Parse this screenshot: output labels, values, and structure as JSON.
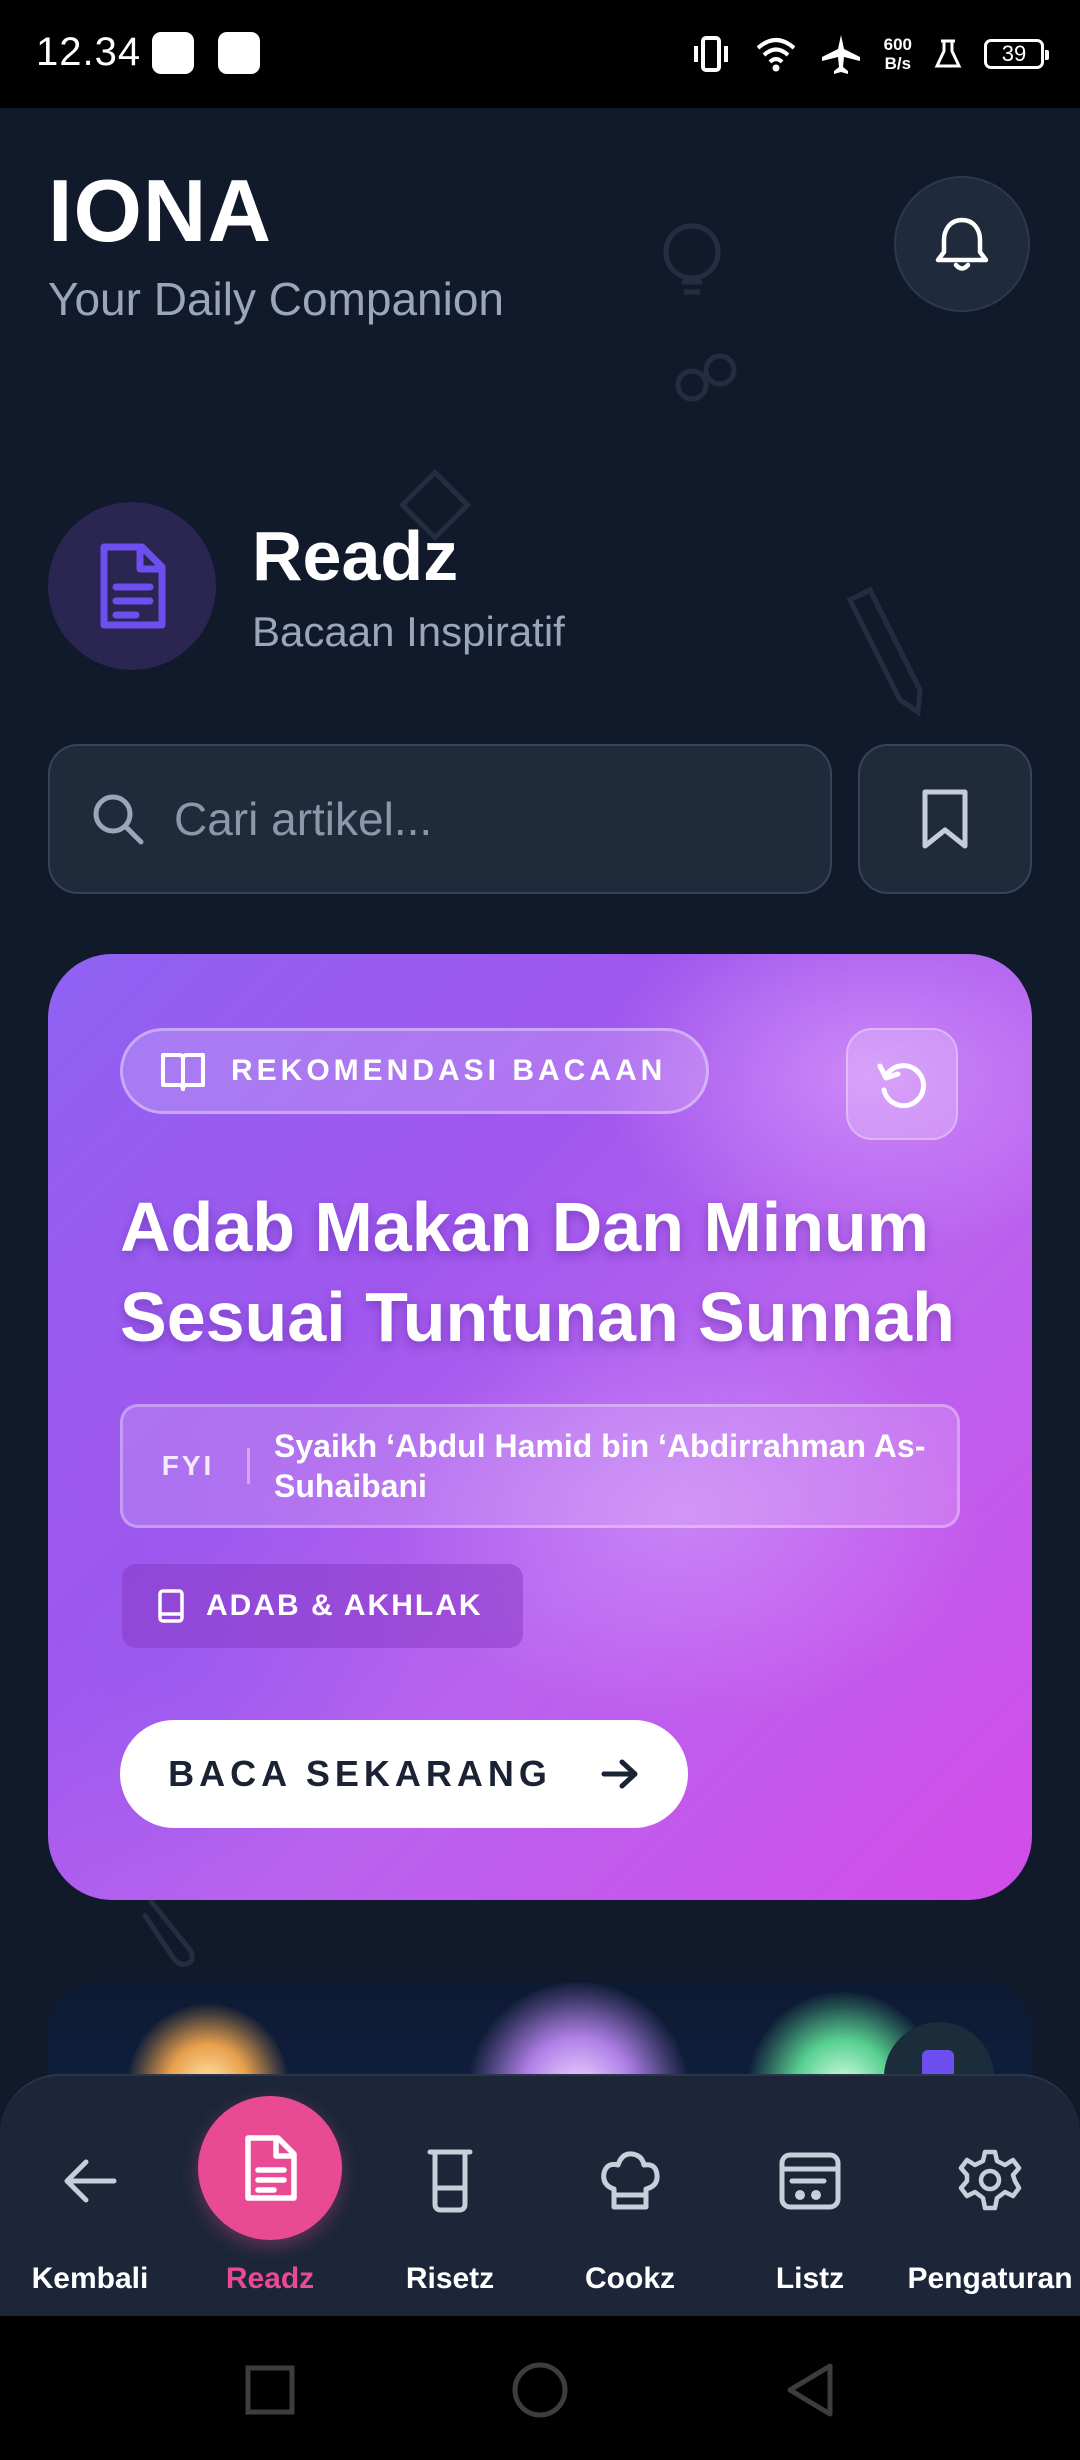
{
  "status_bar": {
    "time": "12.34",
    "net_speed_value": "600",
    "net_speed_unit": "B/s",
    "battery": "39",
    "icons": [
      "vibrate-icon",
      "wifi-icon",
      "airplane-icon",
      "lab-icon",
      "battery-icon"
    ]
  },
  "header": {
    "title": "IONA",
    "subtitle": "Your Daily Companion",
    "notification_icon": "bell-icon"
  },
  "section": {
    "title": "Readz",
    "subtitle": "Bacaan Inspiratif",
    "icon": "document-icon"
  },
  "search": {
    "placeholder": "Cari artikel...",
    "value": "",
    "bookmark_icon": "bookmark-icon"
  },
  "recommendation": {
    "badge": "REKOMENDASI BACAAN",
    "title": "Adab Makan Dan Minum Sesuai Tuntunan Sunnah",
    "fyi_label": "FYI",
    "author": "Syaikh ‘Abdul Hamid bin ‘Abdirrahman As-Suhaibani",
    "category": "ADAB & AKHLAK",
    "read_button": "BACA SEKARANG"
  },
  "bottom_nav": {
    "active": "Readz",
    "items": [
      {
        "label": "Kembali",
        "icon": "arrow-left-icon"
      },
      {
        "label": "Readz",
        "icon": "document-icon"
      },
      {
        "label": "Risetz",
        "icon": "beaker-icon"
      },
      {
        "label": "Cookz",
        "icon": "chef-hat-icon"
      },
      {
        "label": "Listz",
        "icon": "list-icon"
      },
      {
        "label": "Pengaturan",
        "icon": "gear-icon"
      }
    ]
  },
  "colors": {
    "background": "#111a2b",
    "accent_pink": "#e94a94",
    "card_gradient_start": "#8f62f2",
    "card_gradient_end": "#d24ce9",
    "section_icon": "#6d4ff0"
  }
}
